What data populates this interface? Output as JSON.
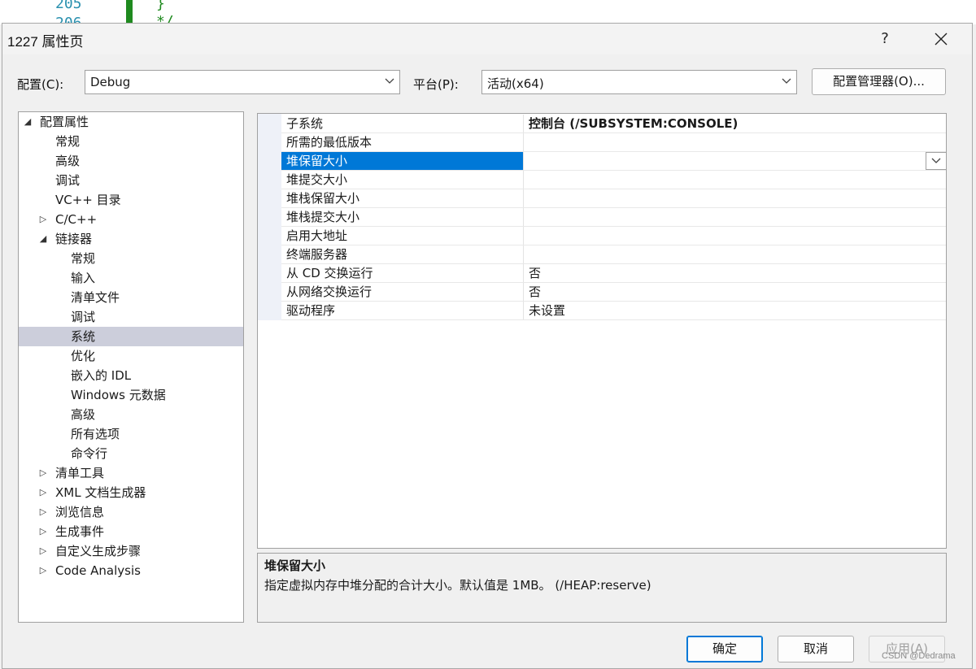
{
  "background_editor": {
    "line_numbers": [
      "205",
      "206"
    ],
    "code_lines": [
      "}",
      "*/"
    ]
  },
  "dialog": {
    "title": "1227 属性页",
    "help_label": "?",
    "close_icon": "close-icon"
  },
  "config": {
    "config_label": "配置(C):",
    "config_value": "Debug",
    "platform_label": "平台(P):",
    "platform_value": "活动(x64)",
    "config_manager_label": "配置管理器(O)..."
  },
  "tree": {
    "items": [
      {
        "label": "配置属性",
        "level": 0,
        "expander": "expanded"
      },
      {
        "label": "常规",
        "level": 1,
        "expander": "none"
      },
      {
        "label": "高级",
        "level": 1,
        "expander": "none"
      },
      {
        "label": "调试",
        "level": 1,
        "expander": "none"
      },
      {
        "label": "VC++ 目录",
        "level": 1,
        "expander": "none"
      },
      {
        "label": "C/C++",
        "level": 1,
        "expander": "collapsed"
      },
      {
        "label": "链接器",
        "level": 1,
        "expander": "expanded"
      },
      {
        "label": "常规",
        "level": 2,
        "expander": "none"
      },
      {
        "label": "输入",
        "level": 2,
        "expander": "none"
      },
      {
        "label": "清单文件",
        "level": 2,
        "expander": "none"
      },
      {
        "label": "调试",
        "level": 2,
        "expander": "none"
      },
      {
        "label": "系统",
        "level": 2,
        "expander": "none",
        "selected": true
      },
      {
        "label": "优化",
        "level": 2,
        "expander": "none"
      },
      {
        "label": "嵌入的 IDL",
        "level": 2,
        "expander": "none"
      },
      {
        "label": "Windows 元数据",
        "level": 2,
        "expander": "none"
      },
      {
        "label": "高级",
        "level": 2,
        "expander": "none"
      },
      {
        "label": "所有选项",
        "level": 2,
        "expander": "none"
      },
      {
        "label": "命令行",
        "level": 2,
        "expander": "none"
      },
      {
        "label": "清单工具",
        "level": 1,
        "expander": "collapsed"
      },
      {
        "label": "XML 文档生成器",
        "level": 1,
        "expander": "collapsed"
      },
      {
        "label": "浏览信息",
        "level": 1,
        "expander": "collapsed"
      },
      {
        "label": "生成事件",
        "level": 1,
        "expander": "collapsed"
      },
      {
        "label": "自定义生成步骤",
        "level": 1,
        "expander": "collapsed"
      },
      {
        "label": "Code Analysis",
        "level": 1,
        "expander": "collapsed"
      }
    ]
  },
  "properties": {
    "rows": [
      {
        "name": "子系统",
        "value": "控制台 (/SUBSYSTEM:CONSOLE)",
        "bold": true
      },
      {
        "name": "所需的最低版本",
        "value": ""
      },
      {
        "name": "堆保留大小",
        "value": "",
        "selected": true
      },
      {
        "name": "堆提交大小",
        "value": ""
      },
      {
        "name": "堆栈保留大小",
        "value": ""
      },
      {
        "name": "堆栈提交大小",
        "value": ""
      },
      {
        "name": "启用大地址",
        "value": ""
      },
      {
        "name": "终端服务器",
        "value": ""
      },
      {
        "name": "从 CD 交换运行",
        "value": "否"
      },
      {
        "name": "从网络交换运行",
        "value": "否"
      },
      {
        "name": "驱动程序",
        "value": "未设置"
      }
    ]
  },
  "description": {
    "title": "堆保留大小",
    "text": "指定虚拟内存中堆分配的合计大小。默认值是 1MB。  (/HEAP:reserve)"
  },
  "buttons": {
    "ok": "确定",
    "cancel": "取消",
    "apply": "应用(A)"
  },
  "colors": {
    "selection_blue": "#0078d7",
    "tree_selection": "#cccedb"
  },
  "watermark": "CSDN @Dedrama"
}
